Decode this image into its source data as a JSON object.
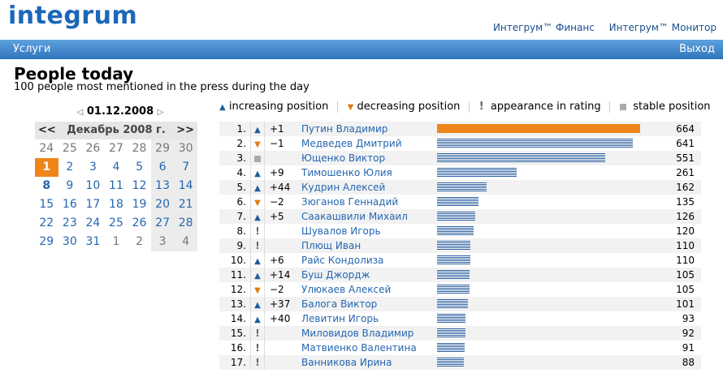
{
  "header": {
    "logo": "integrum",
    "links": [
      "Интегрум™ Финанс",
      "Интегрум™ Монитор"
    ]
  },
  "navbar": {
    "left": "Услуги",
    "right": "Выход"
  },
  "page": {
    "title": "People today",
    "subtitle": "100 people most mentioned in the press during the day"
  },
  "calendar": {
    "date": "01.12.2008",
    "prev": "<<",
    "next": ">>",
    "month": "Декабрь 2008 г.",
    "days": [
      {
        "d": "24",
        "o": true
      },
      {
        "d": "25",
        "o": true
      },
      {
        "d": "26",
        "o": true
      },
      {
        "d": "27",
        "o": true
      },
      {
        "d": "28",
        "o": true
      },
      {
        "d": "29",
        "o": true,
        "w": true
      },
      {
        "d": "30",
        "o": true,
        "w": true
      },
      {
        "d": "1",
        "t": true
      },
      {
        "d": "2"
      },
      {
        "d": "3"
      },
      {
        "d": "4"
      },
      {
        "d": "5"
      },
      {
        "d": "6",
        "w": true
      },
      {
        "d": "7",
        "w": true
      },
      {
        "d": "8",
        "b": true
      },
      {
        "d": "9"
      },
      {
        "d": "10"
      },
      {
        "d": "11"
      },
      {
        "d": "12"
      },
      {
        "d": "13",
        "w": true
      },
      {
        "d": "14",
        "w": true
      },
      {
        "d": "15"
      },
      {
        "d": "16"
      },
      {
        "d": "17"
      },
      {
        "d": "18"
      },
      {
        "d": "19"
      },
      {
        "d": "20",
        "w": true
      },
      {
        "d": "21",
        "w": true
      },
      {
        "d": "22"
      },
      {
        "d": "23"
      },
      {
        "d": "24"
      },
      {
        "d": "25"
      },
      {
        "d": "26"
      },
      {
        "d": "27",
        "w": true
      },
      {
        "d": "28",
        "w": true
      },
      {
        "d": "29"
      },
      {
        "d": "30"
      },
      {
        "d": "31"
      },
      {
        "d": "1",
        "o": true
      },
      {
        "d": "2",
        "o": true
      },
      {
        "d": "3",
        "o": true,
        "w": true
      },
      {
        "d": "4",
        "o": true,
        "w": true
      }
    ]
  },
  "legend": {
    "up": "increasing position",
    "down": "decreasing position",
    "new": "appearance in rating",
    "stable": "stable position"
  },
  "max_value": 664,
  "rows": [
    {
      "rank": "1.",
      "ind": "up",
      "chg": "+1",
      "name": "Путин Владимир",
      "value": 664
    },
    {
      "rank": "2.",
      "ind": "down",
      "chg": "−1",
      "name": "Медведев Дмитрий",
      "value": 641
    },
    {
      "rank": "3.",
      "ind": "stable",
      "chg": "",
      "name": "Ющенко Виктор",
      "value": 551
    },
    {
      "rank": "4.",
      "ind": "up",
      "chg": "+9",
      "name": "Тимошенко Юлия",
      "value": 261
    },
    {
      "rank": "5.",
      "ind": "up",
      "chg": "+44",
      "name": "Кудрин Алексей",
      "value": 162
    },
    {
      "rank": "6.",
      "ind": "down",
      "chg": "−2",
      "name": "Зюганов Геннадий",
      "value": 135
    },
    {
      "rank": "7.",
      "ind": "up",
      "chg": "+5",
      "name": "Саакашвили Михаил",
      "value": 126
    },
    {
      "rank": "8.",
      "ind": "new",
      "chg": "",
      "name": "Шувалов Игорь",
      "value": 120
    },
    {
      "rank": "9.",
      "ind": "new",
      "chg": "",
      "name": "Плющ Иван",
      "value": 110
    },
    {
      "rank": "10.",
      "ind": "up",
      "chg": "+6",
      "name": "Райс Кондолиза",
      "value": 110
    },
    {
      "rank": "11.",
      "ind": "up",
      "chg": "+14",
      "name": "Буш Джордж",
      "value": 105
    },
    {
      "rank": "12.",
      "ind": "down",
      "chg": "−2",
      "name": "Улюкаев Алексей",
      "value": 105
    },
    {
      "rank": "13.",
      "ind": "up",
      "chg": "+37",
      "name": "Балога Виктор",
      "value": 101
    },
    {
      "rank": "14.",
      "ind": "up",
      "chg": "+40",
      "name": "Левитин Игорь",
      "value": 93
    },
    {
      "rank": "15.",
      "ind": "new",
      "chg": "",
      "name": "Миловидов Владимир",
      "value": 92
    },
    {
      "rank": "16.",
      "ind": "new",
      "chg": "",
      "name": "Матвиенко Валентина",
      "value": 91
    },
    {
      "rank": "17.",
      "ind": "new",
      "chg": "",
      "name": "Ванникова Ирина",
      "value": 88
    }
  ]
}
